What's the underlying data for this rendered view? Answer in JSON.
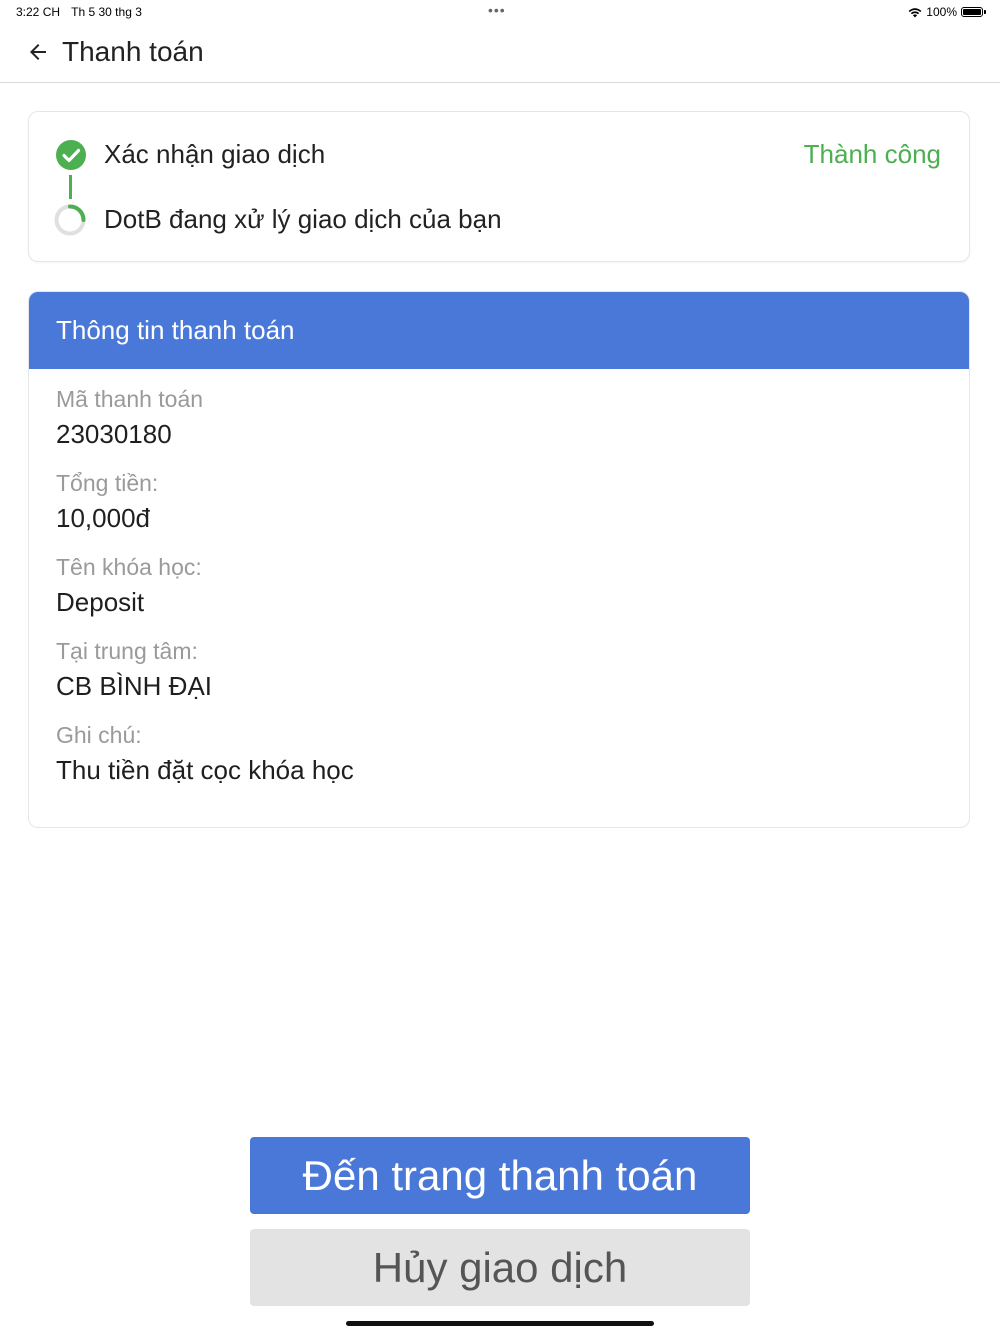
{
  "status_bar": {
    "time": "3:22 CH",
    "date": "Th 5 30 thg 3",
    "more": "•••",
    "battery": "100%"
  },
  "app_bar": {
    "title": "Thanh toán",
    "back_icon": "arrow-left-icon"
  },
  "transaction_status": {
    "steps": [
      {
        "label": "Xác nhận giao dịch",
        "status": "Thành công",
        "icon": "check-circle-icon"
      },
      {
        "label": "DotB đang xử lý giao dịch của bạn",
        "icon": "spinner-icon"
      }
    ],
    "colors": {
      "success": "#4caf50",
      "connector": "#4caf50"
    }
  },
  "payment_info": {
    "header": "Thông tin thanh toán",
    "header_color": "#4a78d8",
    "items": [
      {
        "label": "Mã thanh toán",
        "value": "23030180"
      },
      {
        "label": "Tổng tiền:",
        "value": "10,000đ"
      },
      {
        "label": "Tên khóa học:",
        "value": "Deposit"
      },
      {
        "label": "Tại trung tâm:",
        "value": "CB BÌNH ĐẠI"
      },
      {
        "label": "Ghi chú:",
        "value": "Thu tiền đặt cọc khóa học"
      }
    ]
  },
  "actions": {
    "primary_label": "Đến trang thanh toán",
    "secondary_label": "Hủy giao dịch",
    "primary_color": "#4a78d8",
    "secondary_color": "#e3e3e3"
  }
}
